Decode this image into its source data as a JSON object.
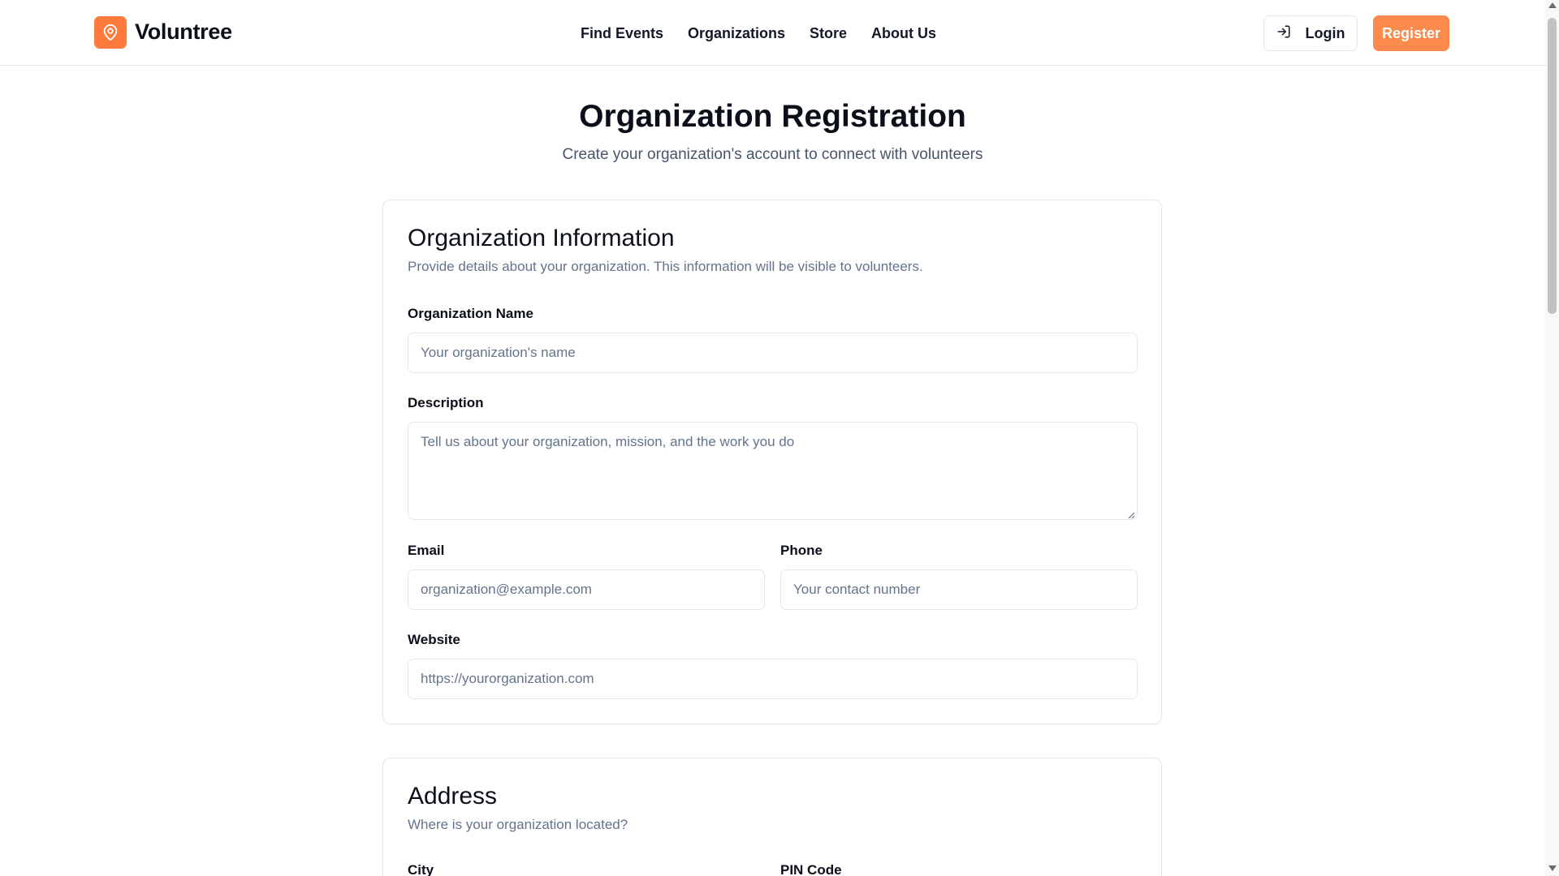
{
  "header": {
    "brand": "Voluntree",
    "nav": [
      "Find Events",
      "Organizations",
      "Store",
      "About Us"
    ],
    "login_label": "Login",
    "register_label": "Register"
  },
  "page": {
    "title": "Organization Registration",
    "subtitle": "Create your organization's account to connect with volunteers"
  },
  "org_info": {
    "title": "Organization Information",
    "description": "Provide details about your organization. This information will be visible to volunteers.",
    "name_label": "Organization Name",
    "name_placeholder": "Your organization's name",
    "desc_label": "Description",
    "desc_placeholder": "Tell us about your organization, mission, and the work you do",
    "email_label": "Email",
    "email_placeholder": "organization@example.com",
    "phone_label": "Phone",
    "phone_placeholder": "Your contact number",
    "website_label": "Website",
    "website_placeholder": "https://yourorganization.com"
  },
  "address": {
    "title": "Address",
    "description": "Where is your organization located?",
    "city_label": "City",
    "pin_label": "PIN Code"
  },
  "colors": {
    "accent": "#fb8a4c",
    "logo_bg": "#fb7a3c"
  },
  "icons": {
    "logo": "map-pin-icon",
    "login": "log-in-icon"
  }
}
